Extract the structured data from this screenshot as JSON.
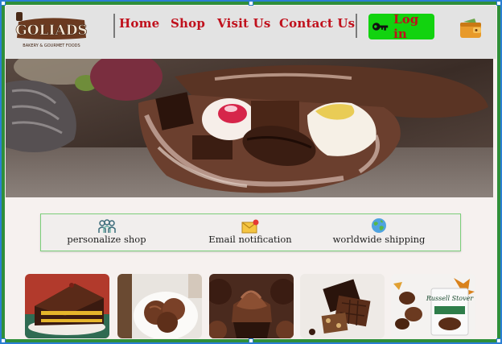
{
  "brand": {
    "logo_text": "GOLIADS",
    "tagline": "BAKERY & GOURMET FOODS"
  },
  "nav": {
    "items": [
      {
        "label": "Home"
      },
      {
        "label": "Shop"
      },
      {
        "label": "Visit Us"
      },
      {
        "label": "Contact Us"
      }
    ],
    "login_label": "Log in",
    "login_icon": "key-icon",
    "wallet_icon": "wallet-icon"
  },
  "hero": {
    "subject": "chocolates in a cacao pod"
  },
  "features": [
    {
      "label": "personalize shop",
      "icon": "people-icon"
    },
    {
      "label": "Email notification",
      "icon": "envelope-icon"
    },
    {
      "label": "worldwide shipping",
      "icon": "globe-icon"
    }
  ],
  "products": [
    {
      "name": "chocolate cake slice",
      "icon": "cake-image"
    },
    {
      "name": "chocolate ice cream",
      "icon": "ice-cream-image"
    },
    {
      "name": "chocolate cupcakes",
      "icon": "cupcake-image"
    },
    {
      "name": "chocolate bar pieces",
      "icon": "chocolate-bar-image"
    },
    {
      "name": "Russell Stover sugar free",
      "icon": "candy-box-image",
      "brand_text": "Russell Stover"
    }
  ],
  "colors": {
    "nav_text": "#c0101c",
    "login_bg": "#12d30f",
    "header_bg": "#e3e3e3",
    "feature_border": "#7ccf7a"
  }
}
